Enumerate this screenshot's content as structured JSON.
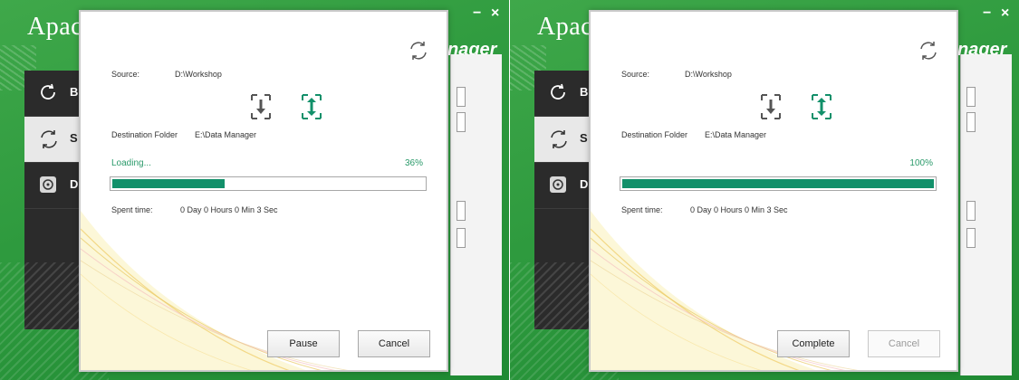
{
  "background_app": {
    "logo_text": "Apac",
    "subtitle": "nager",
    "minimize_glyph": "−",
    "close_glyph": "×",
    "menu_items": [
      {
        "label": "B",
        "icon": "refresh-icon"
      },
      {
        "label": "S",
        "icon": "sync-icon"
      },
      {
        "label": "D",
        "icon": "disc-icon"
      }
    ],
    "accent_color": "#3fa84a"
  },
  "dialogs": [
    {
      "source_label": "Source:",
      "source_value": "D:\\Workshop",
      "destination_label": "Destination Folder",
      "destination_value": "E:\\Data Manager",
      "status_text": "Loading...",
      "percent_text": "36%",
      "progress": 0.36,
      "spent_time_label": "Spent time:",
      "spent_time_value": "0 Day 0 Hours 0 Min 3 Sec",
      "primary_button": "Pause",
      "cancel_button": "Cancel",
      "cancel_disabled": false
    },
    {
      "source_label": "Source:",
      "source_value": "D:\\Workshop",
      "destination_label": "Destination Folder",
      "destination_value": "E:\\Data Manager",
      "status_text": "",
      "percent_text": "100%",
      "progress": 1.0,
      "spent_time_label": "Spent time:",
      "spent_time_value": "0 Day 0 Hours 0 Min 3 Sec",
      "primary_button": "Complete",
      "cancel_button": "Cancel",
      "cancel_disabled": true
    }
  ],
  "colors": {
    "progress_fill": "#12906a",
    "status_text": "#2a9a6a",
    "active_direction": "#12906a",
    "inactive_direction": "#555555"
  },
  "icons": {
    "sync": "sync-icon",
    "download_direction": "download-arrow-icon",
    "bidirectional": "bidirectional-arrow-icon"
  }
}
